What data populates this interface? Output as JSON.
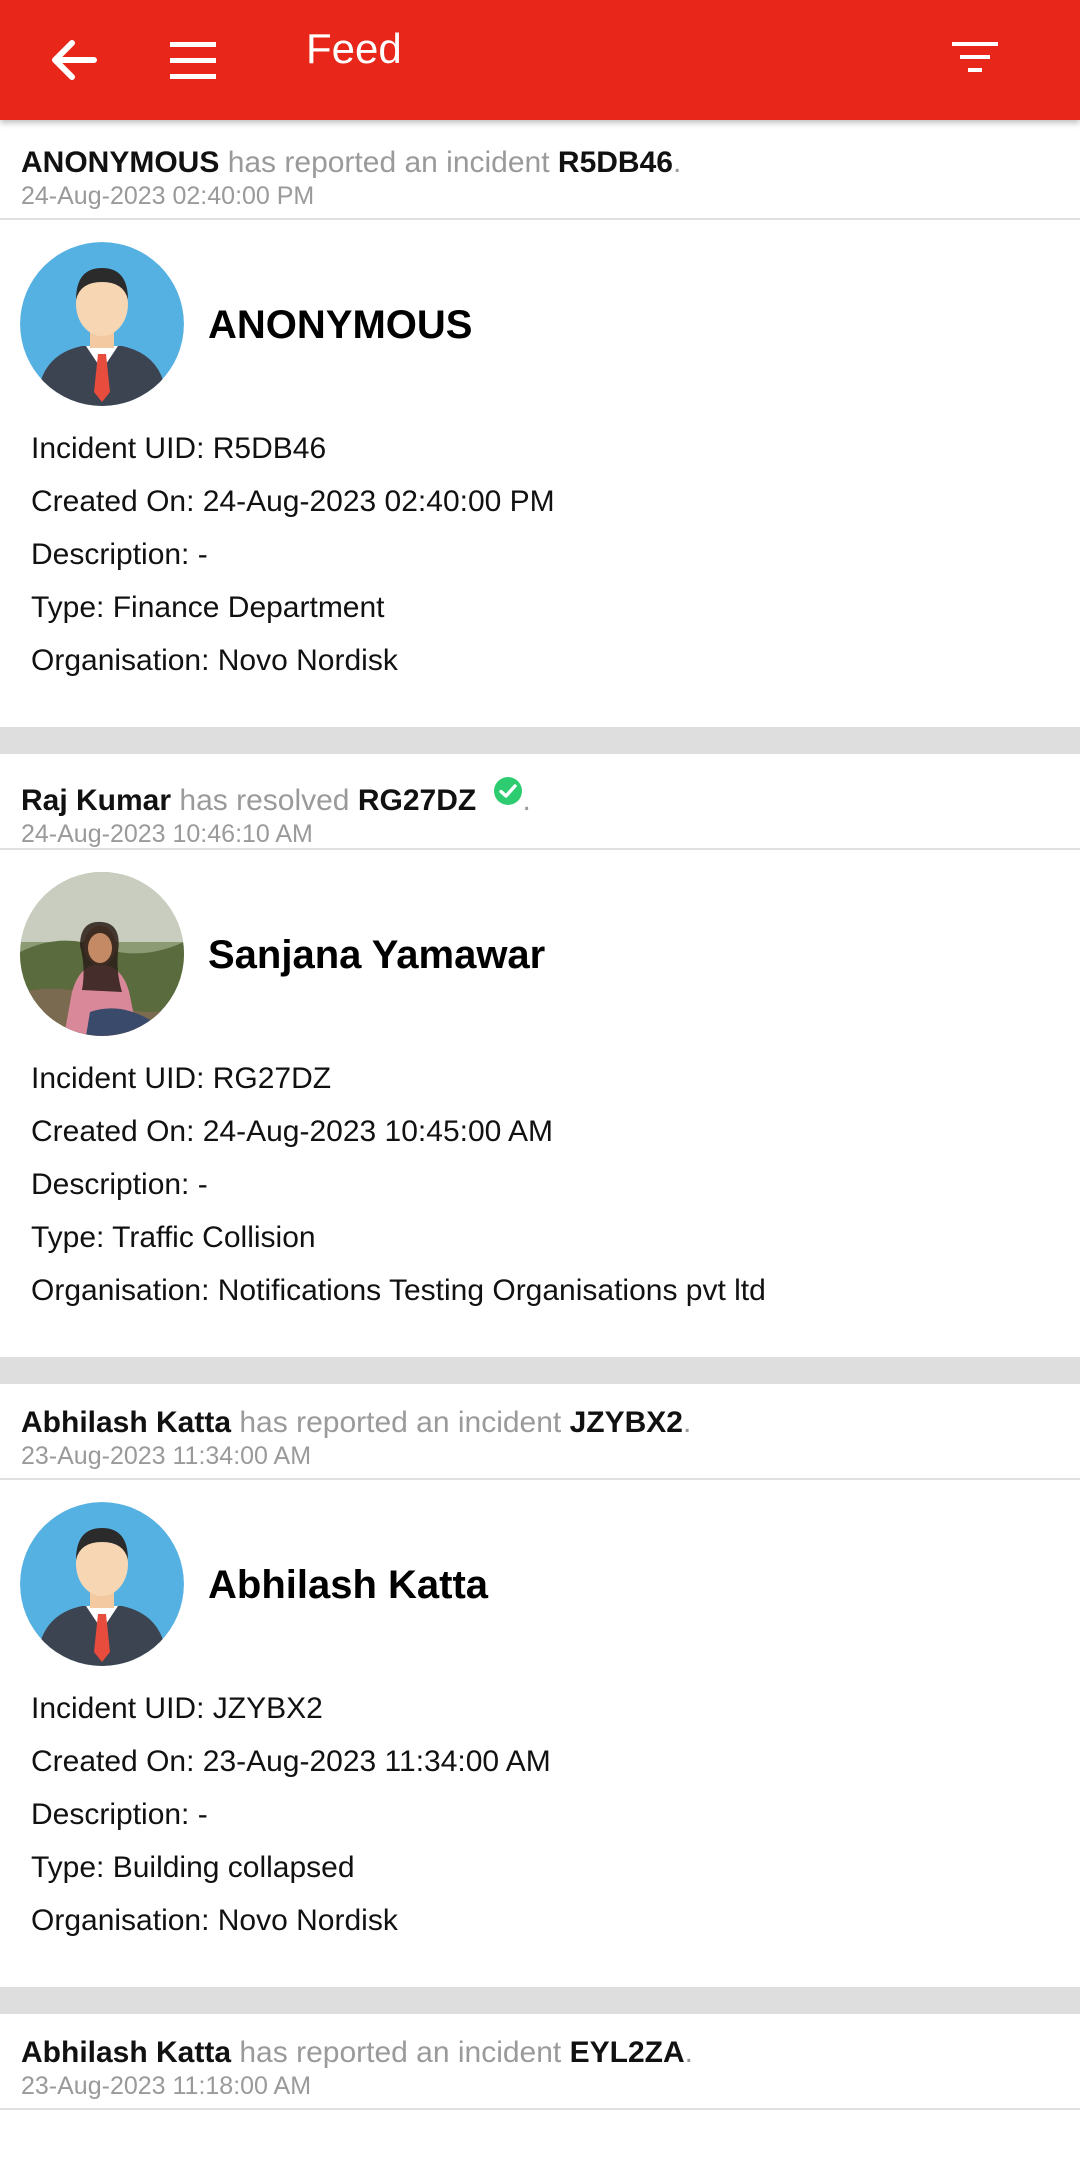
{
  "appbar": {
    "title": "Feed",
    "color": "#e8261a",
    "icons": [
      "back-arrow-icon",
      "hamburger-menu-icon",
      "filter-icon"
    ]
  },
  "feed": [
    {
      "actor": "ANONYMOUS",
      "verb": "has reported an incident",
      "uid": "R5DB46",
      "resolved": false,
      "time": "24-Aug-2023 02:40:00 PM",
      "person": "ANONYMOUS",
      "avatar": "default-avatar",
      "details": [
        "Incident UID: R5DB46",
        "Created On: 24-Aug-2023 02:40:00 PM",
        "Description: -",
        "Type: Finance Department",
        "Organisation: Novo Nordisk"
      ]
    },
    {
      "actor": "Raj Kumar",
      "verb": "has resolved",
      "uid": "RG27DZ",
      "resolved": true,
      "time": "24-Aug-2023 10:46:10 AM",
      "person": "Sanjana Yamawar",
      "avatar": "photo-avatar",
      "details": [
        "Incident UID: RG27DZ",
        "Created On: 24-Aug-2023 10:45:00 AM",
        "Description: -",
        "Type: Traffic Collision",
        "Organisation: Notifications Testing Organisations pvt ltd"
      ]
    },
    {
      "actor": "Abhilash Katta",
      "verb": "has reported an incident",
      "uid": "JZYBX2",
      "resolved": false,
      "time": "23-Aug-2023 11:34:00 AM",
      "person": "Abhilash Katta",
      "avatar": "default-avatar",
      "details": [
        "Incident UID: JZYBX2",
        "Created On: 23-Aug-2023 11:34:00 AM",
        "Description: -",
        "Type: Building collapsed",
        "Organisation: Novo Nordisk"
      ]
    },
    {
      "actor": "Abhilash Katta",
      "verb": "has reported an incident",
      "uid": "EYL2ZA",
      "resolved": false,
      "time": "23-Aug-2023 11:18:00 AM",
      "person": "",
      "avatar": "",
      "details": []
    }
  ],
  "colors": {
    "resolved_check": "#2ecc71",
    "muted_text": "#9a9a9a",
    "separator": "#dedede"
  }
}
